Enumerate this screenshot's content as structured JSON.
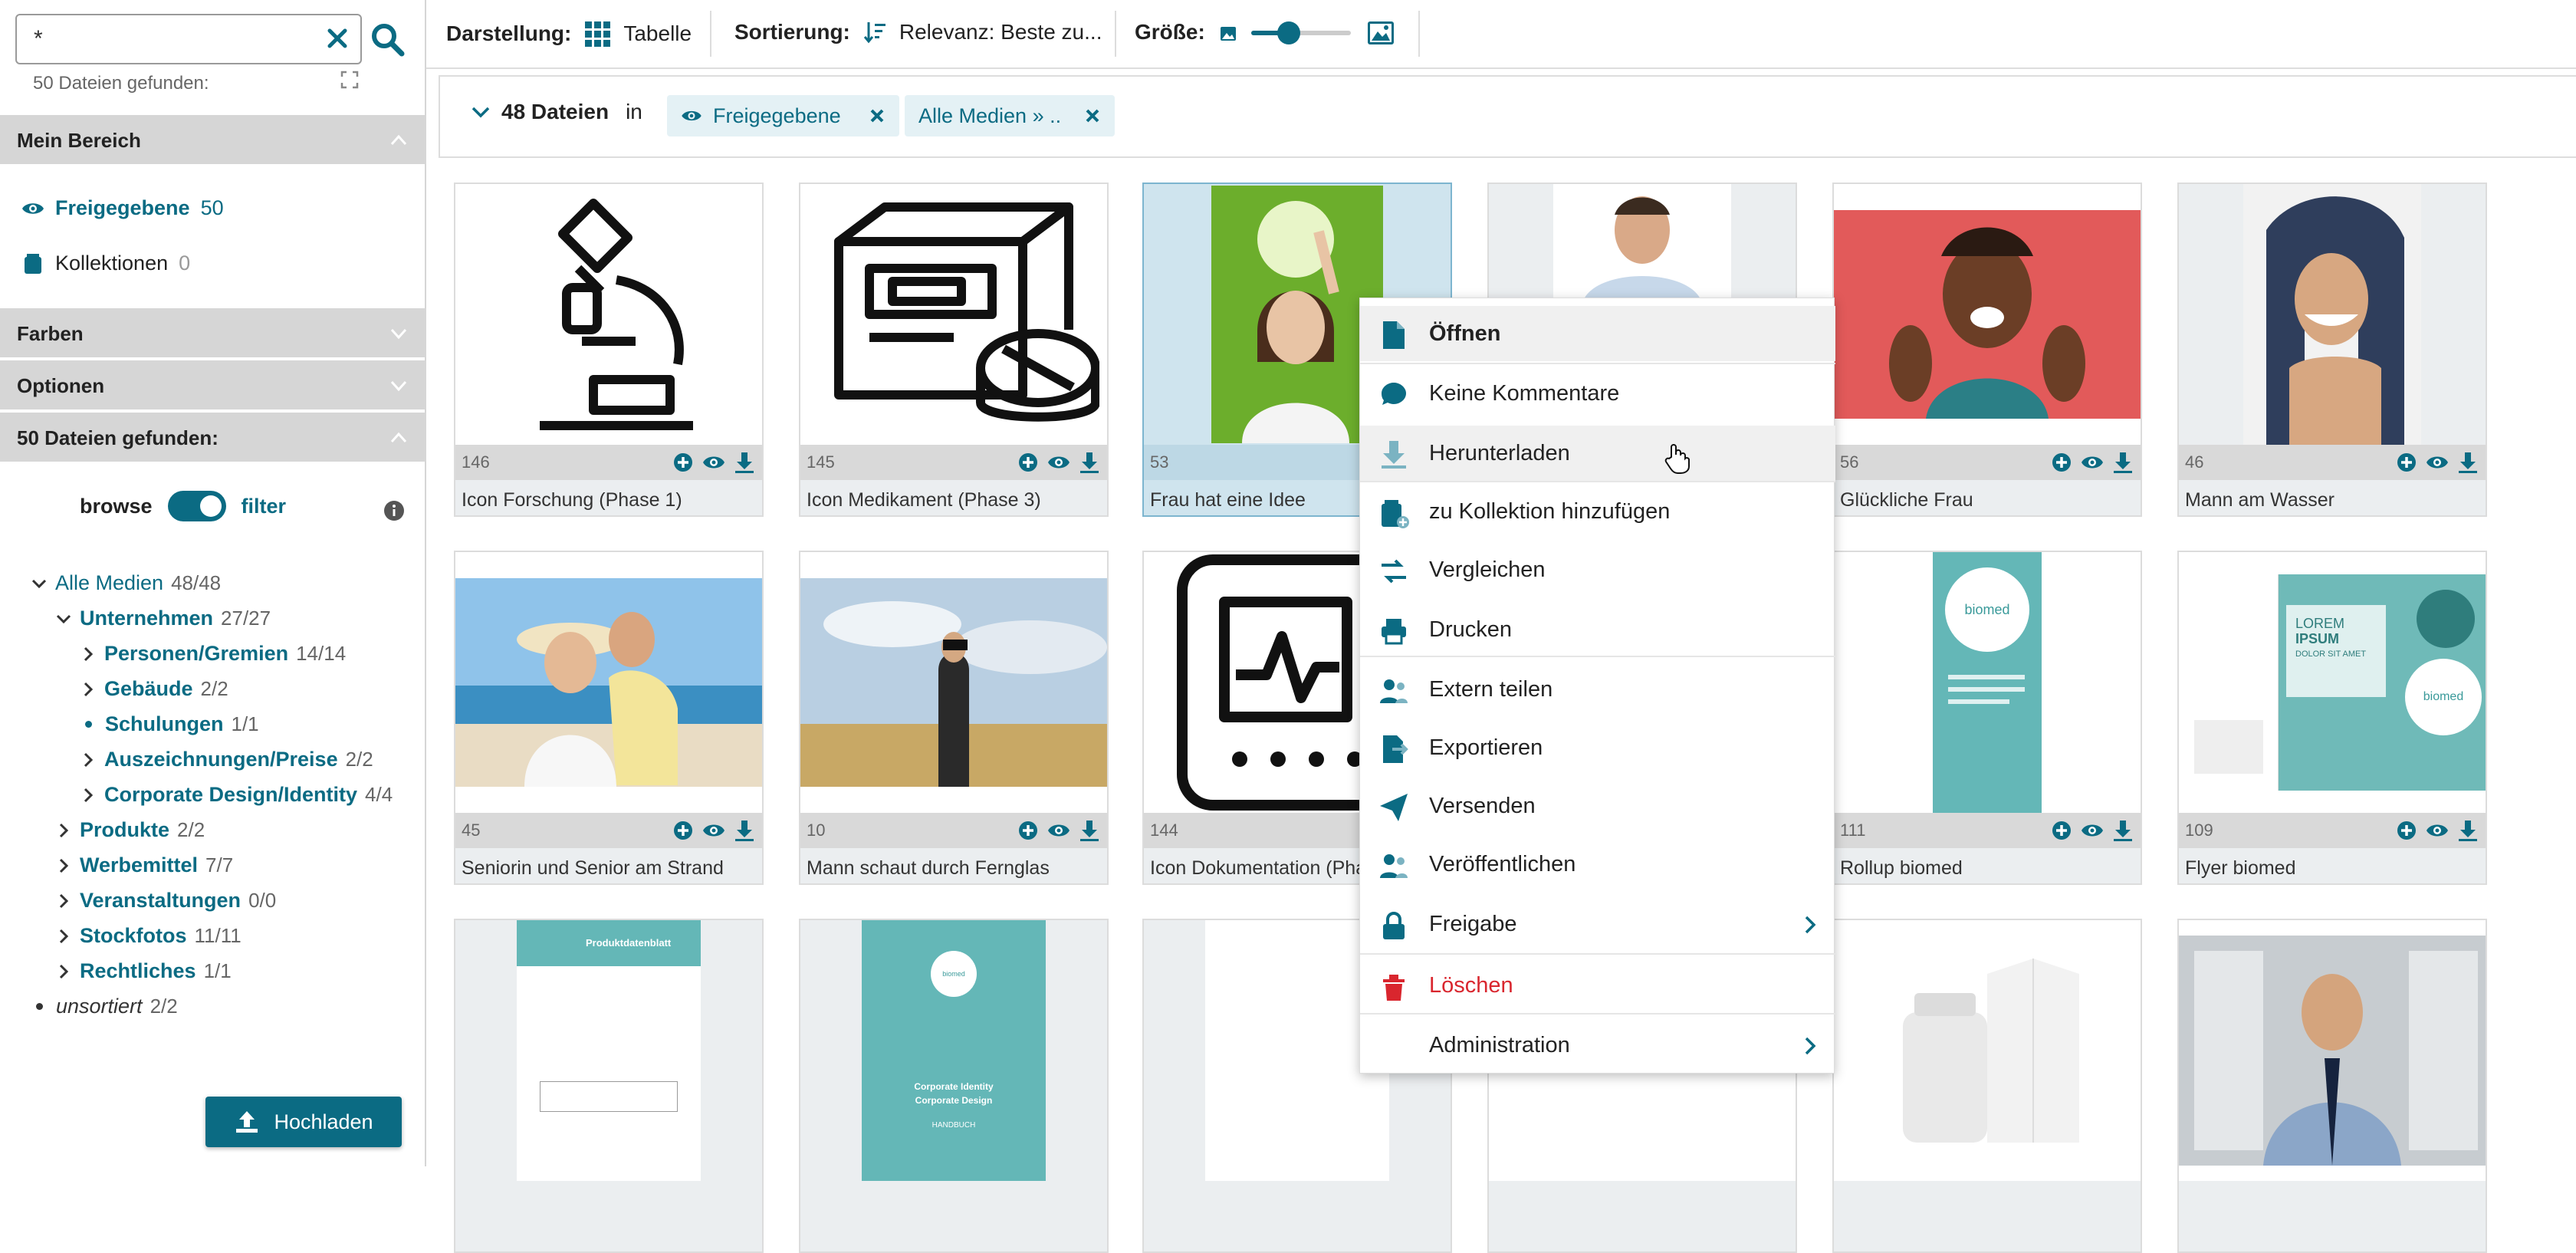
{
  "search": {
    "value": "*",
    "found": "50 Dateien gefunden:"
  },
  "sidebar": {
    "mein_bereich": "Mein Bereich",
    "freigegebene": {
      "label": "Freigegebene",
      "count": "50"
    },
    "kollektionen": {
      "label": "Kollektionen",
      "count": "0"
    },
    "farben": "Farben",
    "optionen": "Optionen",
    "found_section": "50 Dateien gefunden:",
    "browse": "browse",
    "filter": "filter",
    "tree": [
      {
        "label": "Alle Medien",
        "count": "48/48"
      },
      {
        "label": "Unternehmen",
        "count": "27/27"
      },
      {
        "label": "Personen/Gremien",
        "count": "14/14"
      },
      {
        "label": "Gebäude",
        "count": "2/2"
      },
      {
        "label": "Schulungen",
        "count": "1/1"
      },
      {
        "label": "Auszeichnungen/Preise",
        "count": "2/2"
      },
      {
        "label": "Corporate Design/Identity",
        "count": "4/4"
      },
      {
        "label": "Produkte",
        "count": "2/2"
      },
      {
        "label": "Werbemittel",
        "count": "7/7"
      },
      {
        "label": "Veranstaltungen",
        "count": "0/0"
      },
      {
        "label": "Stockfotos",
        "count": "11/11"
      },
      {
        "label": "Rechtliches",
        "count": "1/1"
      },
      {
        "label": "unsortiert",
        "count": "2/2"
      }
    ],
    "upload": "Hochladen"
  },
  "topbar": {
    "darstellung": "Darstellung:",
    "tabelle": "Tabelle",
    "sortierung": "Sortierung:",
    "relevanz": "Relevanz: Beste zu...",
    "groesse": "Größe:"
  },
  "filterbar": {
    "count": "48 Dateien",
    "in": "in",
    "chip1": "Freigegebene",
    "chip2": "Alle Medien » .."
  },
  "cards": [
    {
      "num": "146",
      "title": "Icon Forschung (Phase 1)"
    },
    {
      "num": "145",
      "title": "Icon Medikament (Phase 3)"
    },
    {
      "num": "53",
      "title": "Frau hat eine Idee"
    },
    {
      "num": "",
      "title": ""
    },
    {
      "num": "56",
      "title": "Glückliche Frau"
    },
    {
      "num": "46",
      "title": "Mann am Wasser"
    },
    {
      "num": "45",
      "title": "Seniorin und Senior am Strand"
    },
    {
      "num": "10",
      "title": "Mann schaut durch Fernglas"
    },
    {
      "num": "144",
      "title": "Icon Dokumentation (Phase"
    },
    {
      "num": "",
      "title": ""
    },
    {
      "num": "111",
      "title": "Rollup biomed"
    },
    {
      "num": "109",
      "title": "Flyer biomed"
    }
  ],
  "thumb_text": {
    "biomed": "biomed",
    "lorem": "LOREM",
    "ipsum": "IPSUM",
    "dolor": "DOLOR SIT AMET",
    "cd1": "Corporate Identity",
    "cd2": "Corporate Design",
    "handbuch": "HANDBUCH",
    "produkt": "Produktdatenblatt"
  },
  "context_menu": [
    {
      "label": "Öffnen",
      "color": "#222"
    },
    {
      "label": "Keine Kommentare",
      "color": "#222"
    },
    {
      "label": "Herunterladen",
      "color": "#222"
    },
    {
      "label": "zu Kollektion hinzufügen",
      "color": "#222"
    },
    {
      "label": "Vergleichen",
      "color": "#222"
    },
    {
      "label": "Drucken",
      "color": "#222"
    },
    {
      "label": "Extern teilen",
      "color": "#222"
    },
    {
      "label": "Exportieren",
      "color": "#222"
    },
    {
      "label": "Versenden",
      "color": "#222"
    },
    {
      "label": "Veröffentlichen",
      "color": "#222"
    },
    {
      "label": "Freigabe",
      "color": "#222"
    },
    {
      "label": "Löschen",
      "color": "#d9262e"
    },
    {
      "label": "Administration",
      "color": "#222"
    }
  ],
  "colors": {
    "accent": "#0b6b83",
    "danger": "#d9262e",
    "section_bg": "#d6d6d6"
  }
}
